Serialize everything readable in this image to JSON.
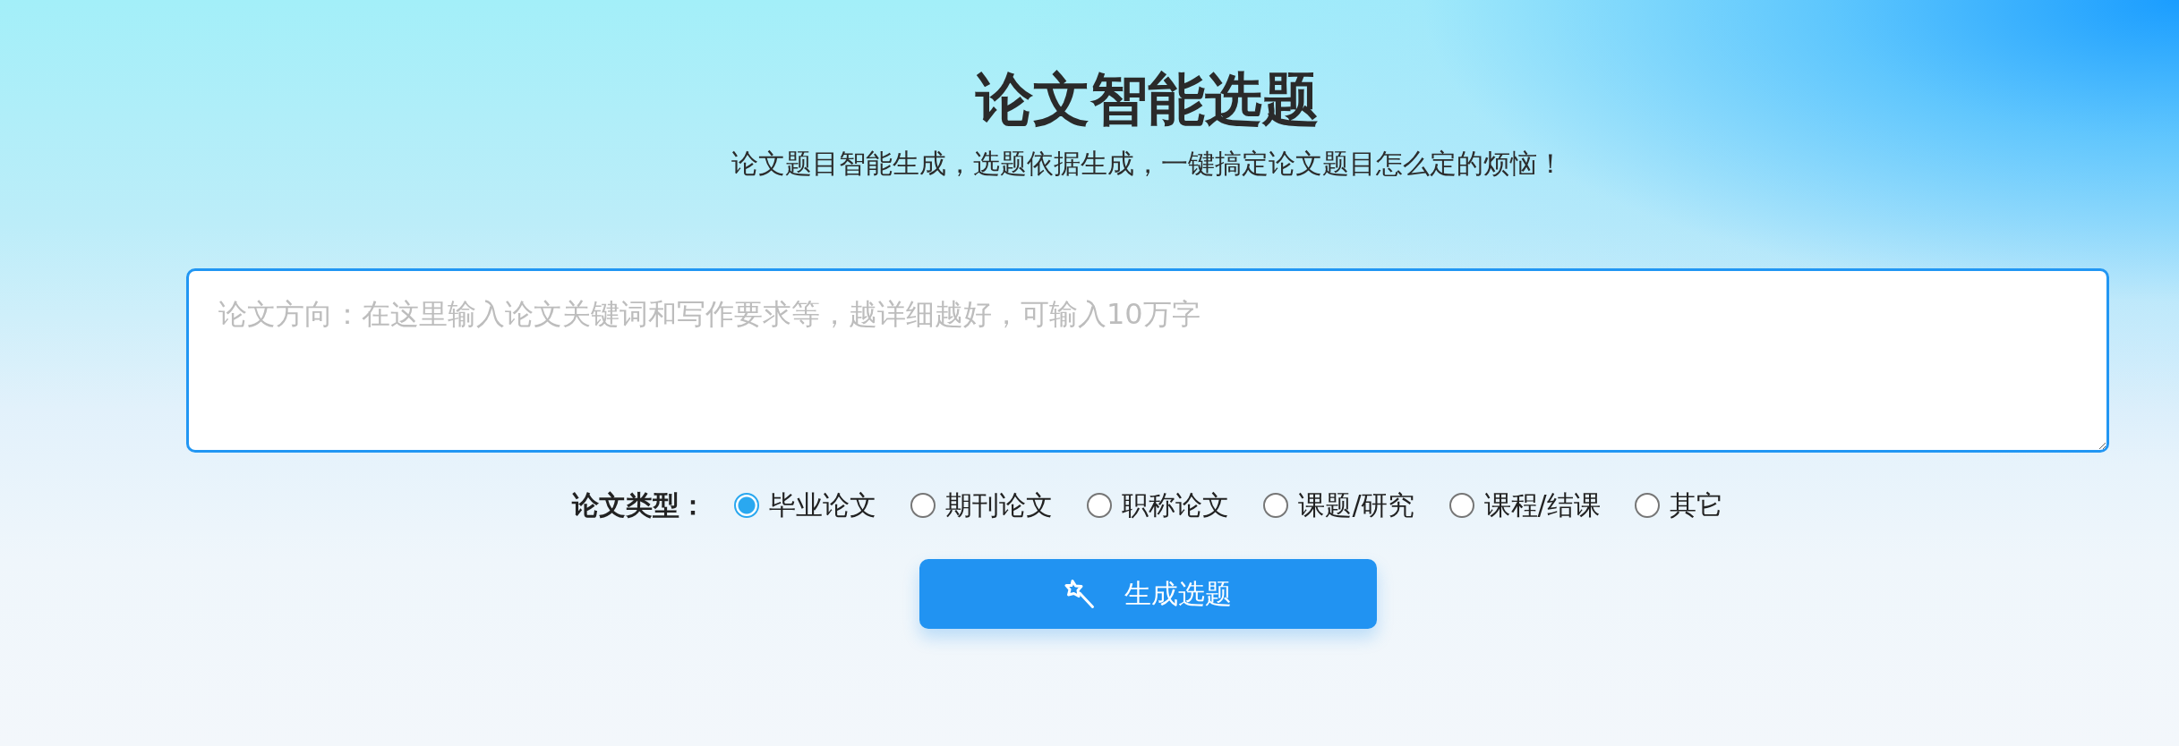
{
  "header": {
    "title": "论文智能选题",
    "subtitle": "论文题目智能生成，选题依据生成，一键搞定论文题目怎么定的烦恼！"
  },
  "topic_field": {
    "placeholder": "论文方向：在这里输入论文关键词和写作要求等，越详细越好，可输入10万字"
  },
  "paper_type": {
    "label": "论文类型：",
    "options": [
      {
        "label": "毕业论文",
        "selected": true
      },
      {
        "label": "期刊论文",
        "selected": false
      },
      {
        "label": "职称论文",
        "selected": false
      },
      {
        "label": "课题/研究",
        "selected": false
      },
      {
        "label": "课程/结课",
        "selected": false
      },
      {
        "label": "其它",
        "selected": false
      }
    ]
  },
  "generate_button": {
    "label": "生成选题"
  }
}
